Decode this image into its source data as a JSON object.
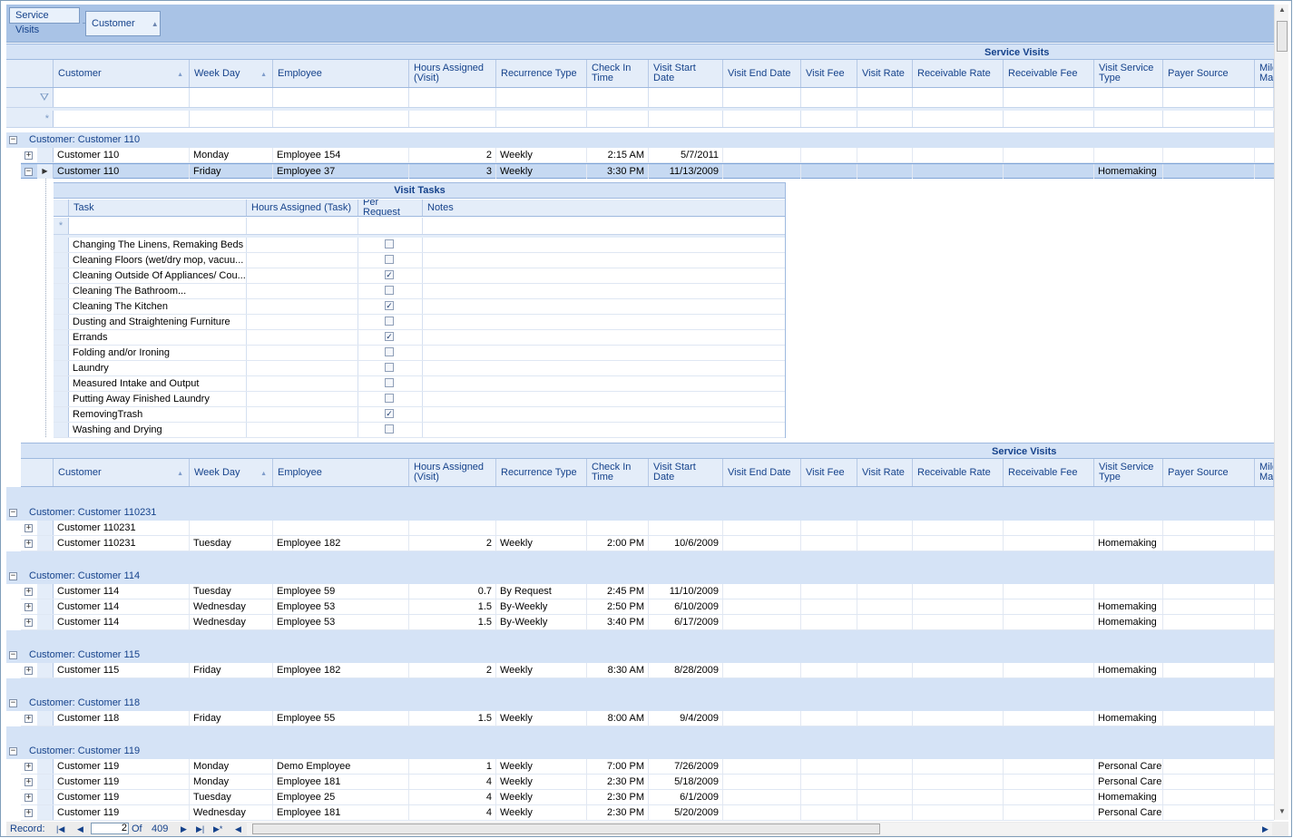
{
  "group_panel": {
    "chips": [
      "Service Visits",
      "Customer"
    ]
  },
  "band_title": "Service Visits",
  "columns": [
    "Customer",
    "Week Day",
    "Employee",
    "Hours Assigned (Visit)",
    "Recurrence Type",
    "Check In Time",
    "Visit Start Date",
    "Visit End Date",
    "Visit Fee",
    "Visit Rate",
    "Receivable Rate",
    "Receivable Fee",
    "Visit Service Type",
    "Payer Source",
    "Mile Mal"
  ],
  "first_group": {
    "label": "Customer:  Customer 110",
    "rows": [
      [
        "Customer 110",
        "Monday",
        "Employee 154",
        "2",
        "Weekly",
        "2:15 AM",
        "5/7/2011",
        "",
        "",
        "",
        "",
        "",
        "",
        ""
      ],
      [
        "Customer 110",
        "Friday",
        "Employee 37",
        "3",
        "Weekly",
        "3:30 PM",
        "11/13/2009",
        "",
        "",
        "",
        "",
        "",
        "Homemaking",
        ""
      ]
    ]
  },
  "detail": {
    "title": "Visit Tasks",
    "columns": [
      "Task",
      "Hours Assigned (Task)",
      "Per Request",
      "Notes"
    ],
    "tasks": [
      {
        "name": "Changing The Linens, Remaking Beds",
        "checked": false
      },
      {
        "name": "Cleaning Floors (wet/dry mop, vacuu...",
        "checked": false
      },
      {
        "name": "Cleaning Outside Of Appliances/ Cou...",
        "checked": true
      },
      {
        "name": "Cleaning The Bathroom...",
        "checked": false
      },
      {
        "name": "Cleaning The Kitchen",
        "checked": true
      },
      {
        "name": "Dusting and Straightening Furniture",
        "checked": false
      },
      {
        "name": "Errands",
        "checked": true
      },
      {
        "name": "Folding and/or Ironing",
        "checked": false
      },
      {
        "name": "Laundry",
        "checked": false
      },
      {
        "name": "Measured Intake and Output",
        "checked": false
      },
      {
        "name": "Putting Away Finished Laundry",
        "checked": false
      },
      {
        "name": "RemovingTrash",
        "checked": true
      },
      {
        "name": "Washing and Drying",
        "checked": false
      }
    ]
  },
  "groups": [
    {
      "label": "Customer:  Customer 110231",
      "rows": [
        [
          "Customer 110231",
          "",
          "",
          "",
          "",
          "",
          "",
          "",
          "",
          "",
          "",
          "",
          "",
          ""
        ],
        [
          "Customer 110231",
          "Tuesday",
          "Employee 182",
          "2",
          "Weekly",
          "2:00 PM",
          "10/6/2009",
          "",
          "",
          "",
          "",
          "",
          "Homemaking",
          ""
        ]
      ]
    },
    {
      "label": "Customer:  Customer 114",
      "rows": [
        [
          "Customer 114",
          "Tuesday",
          "Employee 59",
          "0.7",
          "By Request",
          "2:45 PM",
          "11/10/2009",
          "",
          "",
          "",
          "",
          "",
          "",
          ""
        ],
        [
          "Customer 114",
          "Wednesday",
          "Employee 53",
          "1.5",
          "By-Weekly",
          "2:50 PM",
          "6/10/2009",
          "",
          "",
          "",
          "",
          "",
          "Homemaking",
          ""
        ],
        [
          "Customer 114",
          "Wednesday",
          "Employee 53",
          "1.5",
          "By-Weekly",
          "3:40 PM",
          "6/17/2009",
          "",
          "",
          "",
          "",
          "",
          "Homemaking",
          ""
        ]
      ]
    },
    {
      "label": "Customer:  Customer 115",
      "rows": [
        [
          "Customer 115",
          "Friday",
          "Employee 182",
          "2",
          "Weekly",
          "8:30 AM",
          "8/28/2009",
          "",
          "",
          "",
          "",
          "",
          "Homemaking",
          ""
        ]
      ]
    },
    {
      "label": "Customer:  Customer 118",
      "rows": [
        [
          "Customer 118",
          "Friday",
          "Employee 55",
          "1.5",
          "Weekly",
          "8:00 AM",
          "9/4/2009",
          "",
          "",
          "",
          "",
          "",
          "Homemaking",
          ""
        ]
      ]
    },
    {
      "label": "Customer:  Customer 119",
      "rows": [
        [
          "Customer 119",
          "Monday",
          "Demo Employee",
          "1",
          "Weekly",
          "7:00 PM",
          "7/26/2009",
          "",
          "",
          "",
          "",
          "",
          "Personal Care",
          ""
        ],
        [
          "Customer 119",
          "Monday",
          "Employee 181",
          "4",
          "Weekly",
          "2:30 PM",
          "5/18/2009",
          "",
          "",
          "",
          "",
          "",
          "Personal Care",
          ""
        ],
        [
          "Customer 119",
          "Tuesday",
          "Employee 25",
          "4",
          "Weekly",
          "2:30 PM",
          "6/1/2009",
          "",
          "",
          "",
          "",
          "",
          "Homemaking",
          ""
        ],
        [
          "Customer 119",
          "Wednesday",
          "Employee 181",
          "4",
          "Weekly",
          "2:30 PM",
          "5/20/2009",
          "",
          "",
          "",
          "",
          "",
          "Personal Care",
          ""
        ]
      ]
    }
  ],
  "navigator": {
    "record_label": "Record:",
    "current": "2",
    "of_label": "Of",
    "total": "409"
  },
  "icons": {
    "filter": "funnel-icon",
    "new_row": "asterisk-icon",
    "expand": "plus-icon",
    "collapse": "minus-icon"
  }
}
